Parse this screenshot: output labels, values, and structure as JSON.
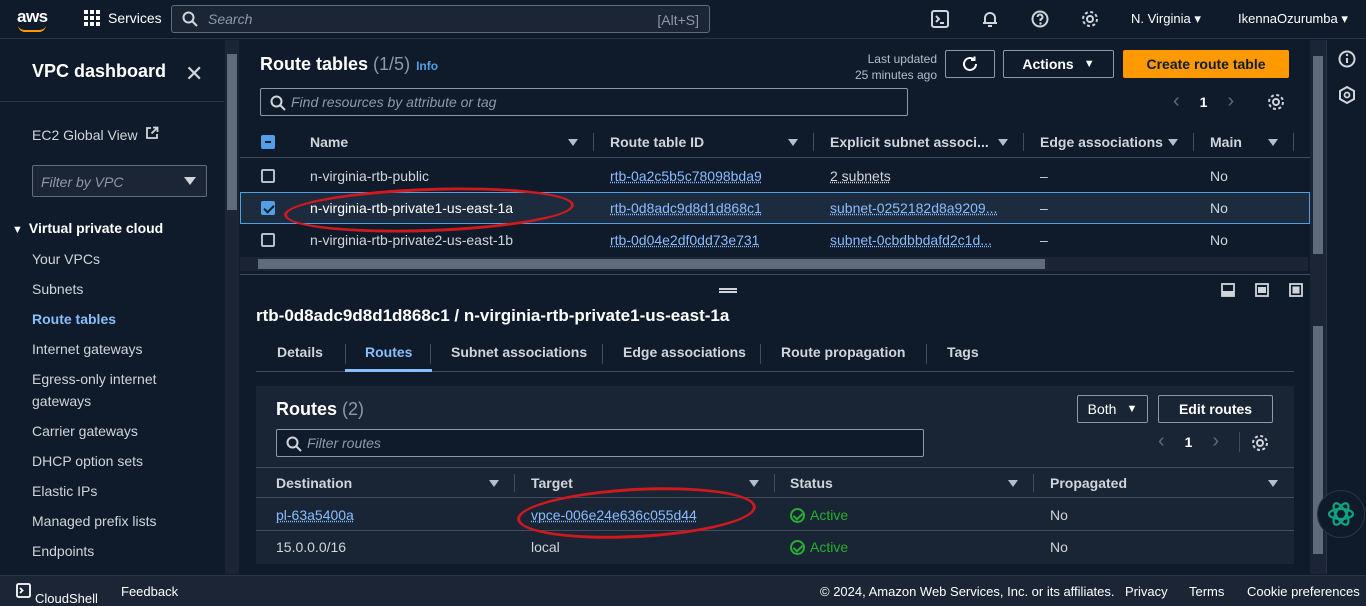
{
  "topnav": {
    "logo": "aws",
    "services": "Services",
    "search_placeholder": "Search",
    "search_shortcut": "[Alt+S]",
    "region": "N. Virginia",
    "user": "IkennaOzurumba"
  },
  "sidebar": {
    "title": "VPC dashboard",
    "ec2": "EC2 Global View",
    "filter_placeholder": "Filter by VPC",
    "section": "Virtual private cloud",
    "items": [
      "Your VPCs",
      "Subnets",
      "Route tables",
      "Internet gateways",
      "Egress-only internet",
      "gateways",
      "Carrier gateways",
      "DHCP option sets",
      "Elastic IPs",
      "Managed prefix lists",
      "Endpoints"
    ]
  },
  "rt": {
    "title": "Route tables",
    "count": "(1/5)",
    "info": "Info",
    "last_updated_1": "Last updated",
    "last_updated_2": "25 minutes ago",
    "actions": "Actions",
    "create": "Create route table",
    "find_placeholder": "Find resources by attribute or tag",
    "page": "1",
    "headers": [
      "Name",
      "Route table ID",
      "Explicit subnet associ...",
      "Edge associations",
      "Main"
    ],
    "rows": [
      {
        "name": "n-virginia-rtb-public",
        "id": "rtb-0a2c5b5c78098bda9",
        "subnet": "2 subnets",
        "edge": "–",
        "main": "No"
      },
      {
        "name": "n-virginia-rtb-private1-us-east-1a",
        "id": "rtb-0d8adc9d8d1d868c1",
        "subnet": "subnet-0252182d8a9209...",
        "edge": "–",
        "main": "No"
      },
      {
        "name": "n-virginia-rtb-private2-us-east-1b",
        "id": "rtb-0d04e2df0dd73e731",
        "subnet": "subnet-0cbdbbdafd2c1d...",
        "edge": "–",
        "main": "No"
      }
    ]
  },
  "detail": {
    "title": "rtb-0d8adc9d8d1d868c1 / n-virginia-rtb-private1-us-east-1a",
    "tabs": [
      "Details",
      "Routes",
      "Subnet associations",
      "Edge associations",
      "Route propagation",
      "Tags"
    ],
    "routes_title": "Routes",
    "routes_count": "(2)",
    "both": "Both",
    "edit": "Edit routes",
    "filter_placeholder": "Filter routes",
    "page": "1",
    "headers": [
      "Destination",
      "Target",
      "Status",
      "Propagated"
    ],
    "rows": [
      {
        "dest": "pl-63a5400a",
        "target": "vpce-006e24e636c055d44",
        "status": "Active",
        "prop": "No"
      },
      {
        "dest": "15.0.0.0/16",
        "target": "local",
        "status": "Active",
        "prop": "No"
      }
    ]
  },
  "footer": {
    "cloudshell": "CloudShell",
    "feedback": "Feedback",
    "copyright": "© 2024, Amazon Web Services, Inc. or its affiliates.",
    "privacy": "Privacy",
    "terms": "Terms",
    "cookies": "Cookie preferences"
  },
  "colors": {
    "accent": "#f90",
    "link": "#89bdff",
    "status_ok": "#29ad32",
    "annotation": "#d0191e"
  }
}
